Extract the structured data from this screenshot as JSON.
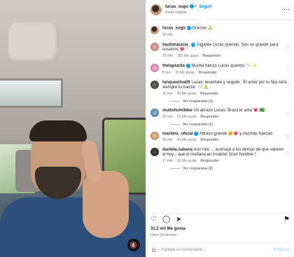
{
  "post": {
    "username": "lucas_sugo",
    "follow_label": "Seguir",
    "audio": "Audio original"
  },
  "comments": [
    {
      "user": "lucas_sugo",
      "text": "Gracias 🙏",
      "time": "30 min",
      "likes": "",
      "reply": "",
      "replies": ""
    },
    {
      "user": "bautimasicia_",
      "text": "Gigante Lucas querido. Sos un grande para nosotros 💗",
      "time": "25 min",
      "likes": "282 Me gusta",
      "reply": "Responder",
      "replies": ""
    },
    {
      "user": "thelaplarita",
      "text": "Mucha fuerza Lucas querido 🤍 ✨",
      "time": "8 min",
      "likes": "35 Me gusta",
      "reply": "Responder",
      "replies": ""
    },
    {
      "user": "tanquesilva09",
      "text": "Lucas, levantate y seguilo . El amor por tu hija será siempre tu fuerza. 🤍 🙏",
      "time": "11 min",
      "likes": "43 Me gusta",
      "reply": "Responder",
      "replies": "Ver respuestas (1)"
    },
    {
      "user": "muitohumildee",
      "text": "Un abrazo Lucas. Brasil te ama 💗 🇧🇷",
      "time": "25 min",
      "likes": "50 Me gusta",
      "reply": "Responder",
      "replies": "Ver respuestas (1)"
    },
    {
      "user": "marilina_oficial",
      "text": "Abrazo grande 😢💗 y muchas fuerzas",
      "time": "25 min",
      "likes": "41 Me gusta",
      "reply": "Responder",
      "replies": ""
    },
    {
      "user": "daniela.cabana",
      "text": "Aún roto ... acorsejá a los demás de que valoren el hoy... que el mañana en incierto! Gran hombre !",
      "time": "27 min",
      "likes": "16 Me gusta",
      "reply": "Responder",
      "replies": "Ver respuestas (2)"
    }
  ],
  "footer": {
    "likes": "31,2 mil Me gusta",
    "time": "Hace 30 minutos",
    "comment_placeholder": "Agrega un comentario...",
    "publish": "Publicar"
  },
  "icons": [
    "heart-icon",
    "comment-icon",
    "share-icon",
    "bookmark-icon",
    "emoji-icon",
    "more-icon",
    "mute-icon"
  ],
  "colors": {
    "accent": "#0095f6",
    "muted": "#737373"
  }
}
